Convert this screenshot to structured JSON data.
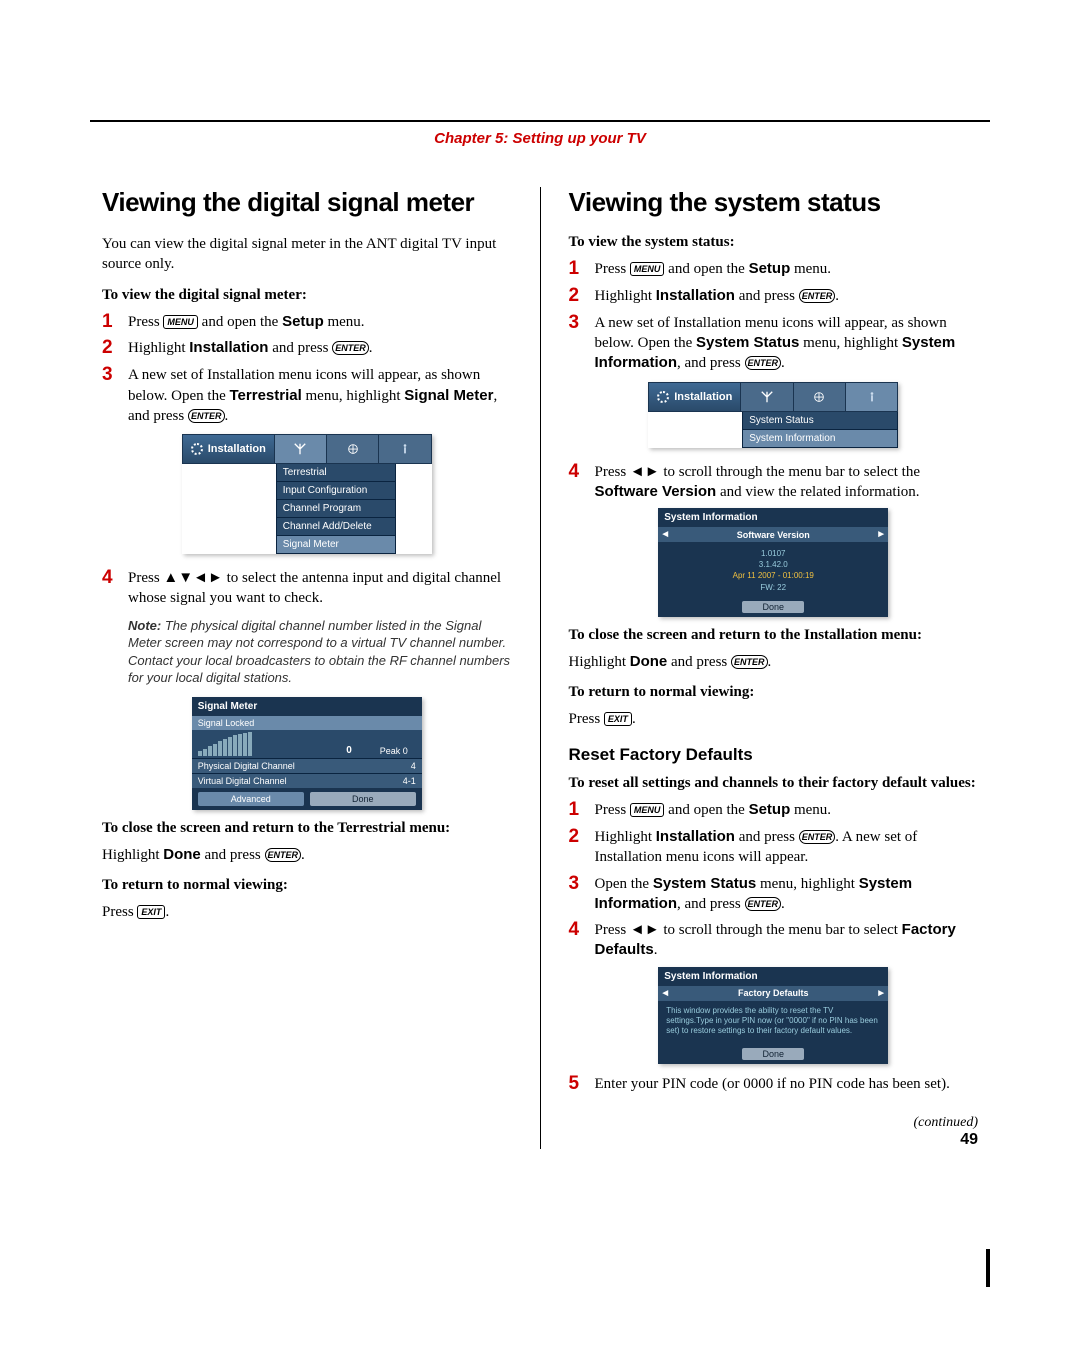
{
  "chapter": "Chapter 5: Setting up your TV",
  "keys": {
    "menu": "MENU",
    "enter": "ENTER",
    "exit": "EXIT"
  },
  "left": {
    "title": "Viewing the digital signal meter",
    "intro": "You can view the digital signal meter in the ANT digital TV input source only.",
    "subhead1": "To view the digital signal meter:",
    "steps_a": {
      "s1a": "Press ",
      "s1b": " and open the ",
      "s1c": " menu.",
      "s1_setup": "Setup",
      "s2a": "Highlight ",
      "s2b": " and press ",
      "s2_install": "Installation",
      "s3a": "A new set of Installation menu icons will appear, as shown below. Open the ",
      "s3b": " menu, highlight ",
      "s3c": ", and press ",
      "s3_terr": "Terrestrial",
      "s3_sig": "Signal Meter",
      "s4a": "Press ",
      "s4arrows": "▲▼◄►",
      "s4b": " to select the antenna input and digital channel whose signal you want to check."
    },
    "mock1": {
      "tab_label": "Installation",
      "items": [
        "Terrestrial",
        "Input Configuration",
        "Channel Program",
        "Channel Add/Delete",
        "Signal Meter"
      ]
    },
    "note_label": "Note:",
    "note_text": " The physical digital channel number listed in the Signal Meter screen may not correspond to a virtual TV channel number. Contact your local broadcasters to obtain the RF channel numbers for your local digital stations.",
    "signal_meter": {
      "head": "Signal Meter",
      "locked": "Signal Locked",
      "zero": "0",
      "peak": "Peak   0",
      "row1l": "Physical Digital Channel",
      "row1r": "4",
      "row2l": "Virtual Digital Channel",
      "row2r": "4-1",
      "btn1": "Advanced",
      "btn2": "Done"
    },
    "close_head": "To close the screen and return to the Terrestrial menu:",
    "close_a": "Highlight ",
    "close_done": "Done",
    "close_b": " and press ",
    "return_head": "To return to normal viewing:",
    "return_a": "Press "
  },
  "right": {
    "title": "Viewing the system status",
    "subhead1": "To view the system status:",
    "steps_a": {
      "s1a": "Press ",
      "s1b": " and open the ",
      "s1c": " menu.",
      "s1_setup": "Setup",
      "s2a": "Highlight ",
      "s2b": " and press ",
      "s2_install": "Installation",
      "s3a": "A new set of Installation menu icons will appear, as shown below. Open the ",
      "s3b": " menu, highlight ",
      "s3c": ", and press ",
      "s3_sys": "System Status",
      "s3_info": "System Information",
      "s4a": "Press ",
      "s4arrows": "◄►",
      "s4b": " to scroll through the menu bar to select the ",
      "s4c": " and view the related information.",
      "s4_sv": "Software Version"
    },
    "mock1": {
      "tab_label": "Installation",
      "items": [
        "System Status",
        "System Information"
      ]
    },
    "sysinfo1": {
      "head": "System Information",
      "tab": "Software Version",
      "l1": "1.0107",
      "l2": "3.1.42.0",
      "l3": "Apr 11 2007 - 01:00:19",
      "l4": "FW:  22",
      "done": "Done"
    },
    "close_head": "To close the screen and return to the Installation menu:",
    "close_a": "Highlight ",
    "close_done": "Done",
    "close_b": " and press ",
    "return_head": "To return to normal viewing:",
    "return_a": "Press ",
    "reset_h2": "Reset Factory Defaults",
    "reset_sub": "To reset all settings and channels to their factory default values:",
    "rs": {
      "s1a": "Press ",
      "s1b": " and open the ",
      "s1c": " menu.",
      "s1_setup": "Setup",
      "s2a": "Highlight ",
      "s2b": " and press ",
      "s2c": ". A new set of Installation menu icons will appear.",
      "s2_install": "Installation",
      "s3a": "Open the ",
      "s3b": " menu, highlight ",
      "s3c": ", and press ",
      "s3_sys": "System Status",
      "s3_info": "System Information",
      "s4a": "Press ",
      "s4arrows": "◄►",
      "s4b": " to scroll through the menu bar to select ",
      "s4_fd": "Factory Defaults",
      "s5": "Enter your PIN code (or 0000 if no PIN code has been set)."
    },
    "fd": {
      "head": "System Information",
      "tab": "Factory Defaults",
      "body": "This window provides the ability to reset the TV settings.Type in your PIN now  (or \"0000\"  if no PIN has been set) to restore settings to their factory default values.",
      "done": "Done"
    }
  },
  "continued": "(continued)",
  "pagenum": "49"
}
